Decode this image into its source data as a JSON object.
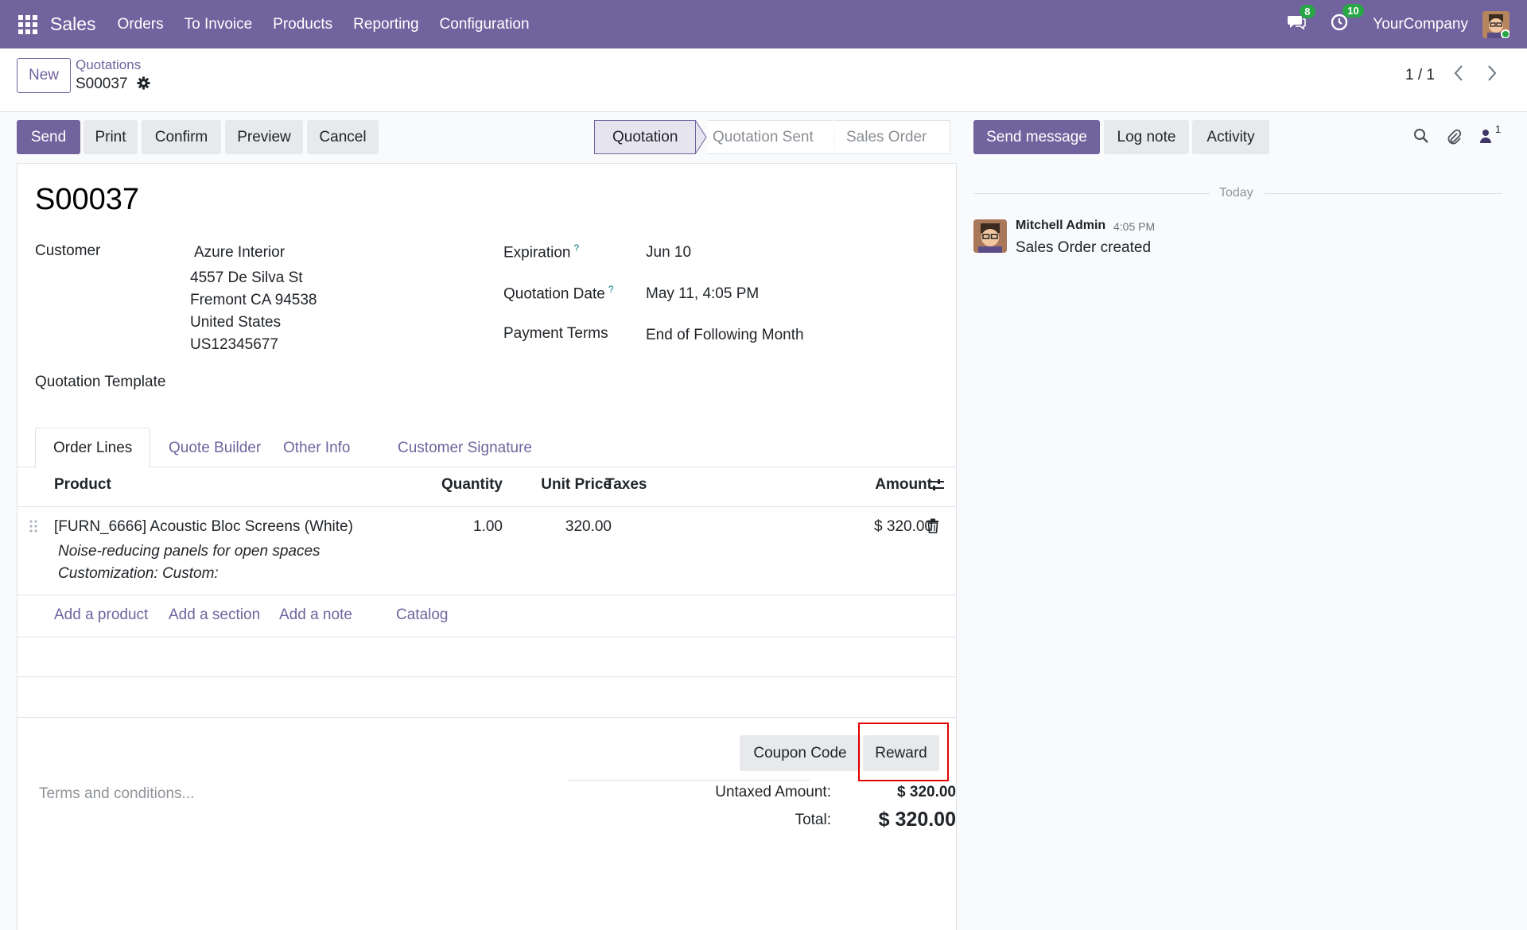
{
  "navbar": {
    "app_name": "Sales",
    "menu": [
      "Orders",
      "To Invoice",
      "Products",
      "Reporting",
      "Configuration"
    ],
    "messages_count": "8",
    "activities_count": "10",
    "company": "YourCompany"
  },
  "control_panel": {
    "new_label": "New",
    "breadcrumb": "Quotations",
    "record": "S00037",
    "pager": "1 / 1"
  },
  "actions": {
    "send": "Send",
    "print": "Print",
    "confirm": "Confirm",
    "preview": "Preview",
    "cancel": "Cancel"
  },
  "statusbar": [
    "Quotation",
    "Quotation Sent",
    "Sales Order"
  ],
  "form": {
    "title": "S00037",
    "customer_label": "Customer",
    "customer_name": "Azure Interior",
    "address": [
      "4557 De Silva St",
      "Fremont CA 94538",
      "United States",
      "US12345677"
    ],
    "template_label": "Quotation Template",
    "expiration_label": "Expiration",
    "expiration_value": "Jun 10",
    "quotation_date_label": "Quotation Date",
    "quotation_date_value": "May 11, 4:05 PM",
    "payment_terms_label": "Payment Terms",
    "payment_terms_value": "End of Following Month",
    "help_mark": "?"
  },
  "tabs": [
    "Order Lines",
    "Quote Builder",
    "Other Info",
    "Customer Signature"
  ],
  "order_lines": {
    "headers": {
      "product": "Product",
      "quantity": "Quantity",
      "unit_price": "Unit Price",
      "taxes": "Taxes",
      "amount": "Amount"
    },
    "rows": [
      {
        "product": "[FURN_6666] Acoustic Bloc Screens (White)",
        "description": "Noise-reducing panels for open spaces",
        "customization": "Customization: Custom:",
        "quantity": "1.00",
        "unit_price": "320.00",
        "amount": "$ 320.00"
      }
    ],
    "links": [
      "Add a product",
      "Add a section",
      "Add a note",
      "Catalog"
    ]
  },
  "footer": {
    "terms_placeholder": "Terms and conditions...",
    "coupon_button": "Coupon Code",
    "reward_button": "Reward",
    "untaxed_label": "Untaxed Amount:",
    "untaxed_value": "$ 320.00",
    "total_label": "Total:",
    "total_value": "$ 320.00"
  },
  "chatter": {
    "send_message": "Send message",
    "log_note": "Log note",
    "activity": "Activity",
    "followers_count": "1",
    "date_separator": "Today",
    "message": {
      "author": "Mitchell Admin",
      "time": "4:05 PM",
      "body": "Sales Order created"
    }
  },
  "colors": {
    "brand": "#71639e",
    "badge": "#28a745",
    "highlight": "#e00000"
  }
}
